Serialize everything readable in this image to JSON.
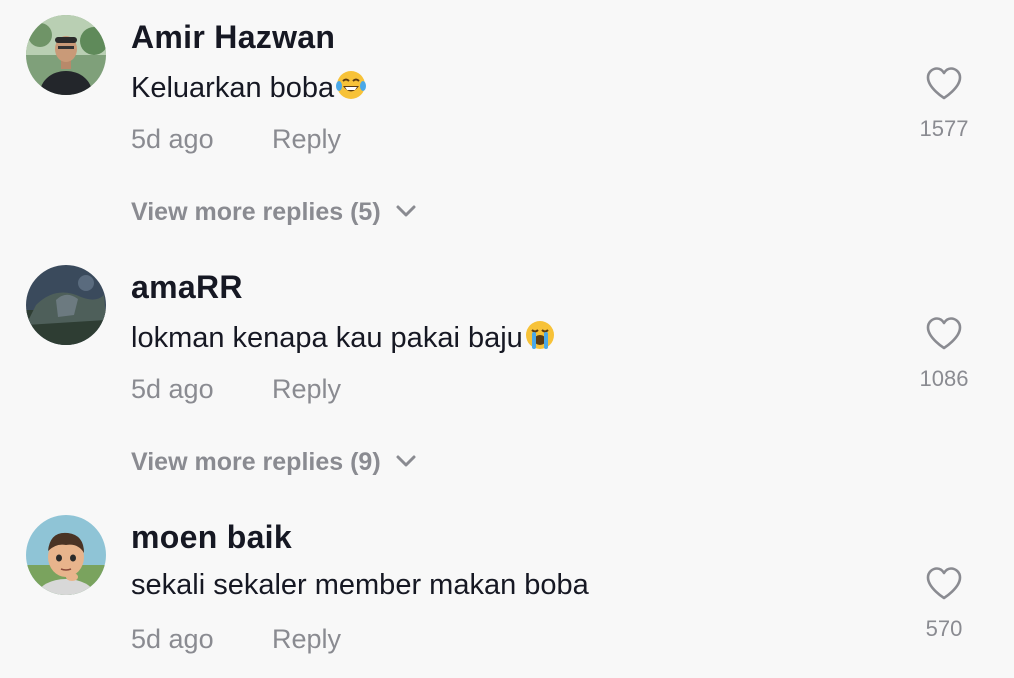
{
  "comments": [
    {
      "username": "Amir Hazwan",
      "text": "Keluarkan boba",
      "emoji": "face-with-tears-of-joy",
      "time": "5d ago",
      "reply_label": "Reply",
      "likes": "1577",
      "view_more": "View more replies (5)"
    },
    {
      "username": "amaRR",
      "text": "lokman kenapa kau pakai baju",
      "emoji": "loudly-crying-face",
      "time": "5d ago",
      "reply_label": "Reply",
      "likes": "1086",
      "view_more": "View more replies (9)"
    },
    {
      "username": "moen baik",
      "text": "sekali sekaler member makan boba",
      "time": "5d ago",
      "reply_label": "Reply",
      "likes": "570"
    }
  ],
  "colors": {
    "background": "#f8f8f8",
    "primary_text": "#161823",
    "secondary_text": "#8a8b91",
    "emoji_yellow": "#f7c238",
    "emoji_tear": "#4aa8e8"
  }
}
